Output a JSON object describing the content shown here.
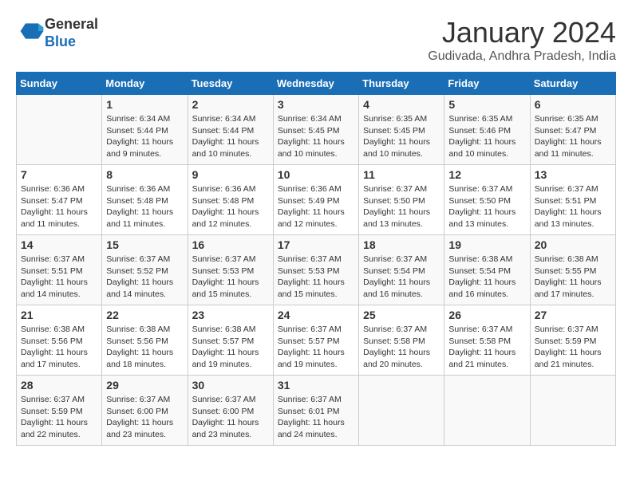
{
  "header": {
    "logo_line1": "General",
    "logo_line2": "Blue",
    "title": "January 2024",
    "subtitle": "Gudivada, Andhra Pradesh, India"
  },
  "calendar": {
    "days_of_week": [
      "Sunday",
      "Monday",
      "Tuesday",
      "Wednesday",
      "Thursday",
      "Friday",
      "Saturday"
    ],
    "weeks": [
      [
        {
          "day": "",
          "sunrise": "",
          "sunset": "",
          "daylight": ""
        },
        {
          "day": "1",
          "sunrise": "Sunrise: 6:34 AM",
          "sunset": "Sunset: 5:44 PM",
          "daylight": "Daylight: 11 hours and 9 minutes."
        },
        {
          "day": "2",
          "sunrise": "Sunrise: 6:34 AM",
          "sunset": "Sunset: 5:44 PM",
          "daylight": "Daylight: 11 hours and 10 minutes."
        },
        {
          "day": "3",
          "sunrise": "Sunrise: 6:34 AM",
          "sunset": "Sunset: 5:45 PM",
          "daylight": "Daylight: 11 hours and 10 minutes."
        },
        {
          "day": "4",
          "sunrise": "Sunrise: 6:35 AM",
          "sunset": "Sunset: 5:45 PM",
          "daylight": "Daylight: 11 hours and 10 minutes."
        },
        {
          "day": "5",
          "sunrise": "Sunrise: 6:35 AM",
          "sunset": "Sunset: 5:46 PM",
          "daylight": "Daylight: 11 hours and 10 minutes."
        },
        {
          "day": "6",
          "sunrise": "Sunrise: 6:35 AM",
          "sunset": "Sunset: 5:47 PM",
          "daylight": "Daylight: 11 hours and 11 minutes."
        }
      ],
      [
        {
          "day": "7",
          "sunrise": "Sunrise: 6:36 AM",
          "sunset": "Sunset: 5:47 PM",
          "daylight": "Daylight: 11 hours and 11 minutes."
        },
        {
          "day": "8",
          "sunrise": "Sunrise: 6:36 AM",
          "sunset": "Sunset: 5:48 PM",
          "daylight": "Daylight: 11 hours and 11 minutes."
        },
        {
          "day": "9",
          "sunrise": "Sunrise: 6:36 AM",
          "sunset": "Sunset: 5:48 PM",
          "daylight": "Daylight: 11 hours and 12 minutes."
        },
        {
          "day": "10",
          "sunrise": "Sunrise: 6:36 AM",
          "sunset": "Sunset: 5:49 PM",
          "daylight": "Daylight: 11 hours and 12 minutes."
        },
        {
          "day": "11",
          "sunrise": "Sunrise: 6:37 AM",
          "sunset": "Sunset: 5:50 PM",
          "daylight": "Daylight: 11 hours and 13 minutes."
        },
        {
          "day": "12",
          "sunrise": "Sunrise: 6:37 AM",
          "sunset": "Sunset: 5:50 PM",
          "daylight": "Daylight: 11 hours and 13 minutes."
        },
        {
          "day": "13",
          "sunrise": "Sunrise: 6:37 AM",
          "sunset": "Sunset: 5:51 PM",
          "daylight": "Daylight: 11 hours and 13 minutes."
        }
      ],
      [
        {
          "day": "14",
          "sunrise": "Sunrise: 6:37 AM",
          "sunset": "Sunset: 5:51 PM",
          "daylight": "Daylight: 11 hours and 14 minutes."
        },
        {
          "day": "15",
          "sunrise": "Sunrise: 6:37 AM",
          "sunset": "Sunset: 5:52 PM",
          "daylight": "Daylight: 11 hours and 14 minutes."
        },
        {
          "day": "16",
          "sunrise": "Sunrise: 6:37 AM",
          "sunset": "Sunset: 5:53 PM",
          "daylight": "Daylight: 11 hours and 15 minutes."
        },
        {
          "day": "17",
          "sunrise": "Sunrise: 6:37 AM",
          "sunset": "Sunset: 5:53 PM",
          "daylight": "Daylight: 11 hours and 15 minutes."
        },
        {
          "day": "18",
          "sunrise": "Sunrise: 6:37 AM",
          "sunset": "Sunset: 5:54 PM",
          "daylight": "Daylight: 11 hours and 16 minutes."
        },
        {
          "day": "19",
          "sunrise": "Sunrise: 6:38 AM",
          "sunset": "Sunset: 5:54 PM",
          "daylight": "Daylight: 11 hours and 16 minutes."
        },
        {
          "day": "20",
          "sunrise": "Sunrise: 6:38 AM",
          "sunset": "Sunset: 5:55 PM",
          "daylight": "Daylight: 11 hours and 17 minutes."
        }
      ],
      [
        {
          "day": "21",
          "sunrise": "Sunrise: 6:38 AM",
          "sunset": "Sunset: 5:56 PM",
          "daylight": "Daylight: 11 hours and 17 minutes."
        },
        {
          "day": "22",
          "sunrise": "Sunrise: 6:38 AM",
          "sunset": "Sunset: 5:56 PM",
          "daylight": "Daylight: 11 hours and 18 minutes."
        },
        {
          "day": "23",
          "sunrise": "Sunrise: 6:38 AM",
          "sunset": "Sunset: 5:57 PM",
          "daylight": "Daylight: 11 hours and 19 minutes."
        },
        {
          "day": "24",
          "sunrise": "Sunrise: 6:37 AM",
          "sunset": "Sunset: 5:57 PM",
          "daylight": "Daylight: 11 hours and 19 minutes."
        },
        {
          "day": "25",
          "sunrise": "Sunrise: 6:37 AM",
          "sunset": "Sunset: 5:58 PM",
          "daylight": "Daylight: 11 hours and 20 minutes."
        },
        {
          "day": "26",
          "sunrise": "Sunrise: 6:37 AM",
          "sunset": "Sunset: 5:58 PM",
          "daylight": "Daylight: 11 hours and 21 minutes."
        },
        {
          "day": "27",
          "sunrise": "Sunrise: 6:37 AM",
          "sunset": "Sunset: 5:59 PM",
          "daylight": "Daylight: 11 hours and 21 minutes."
        }
      ],
      [
        {
          "day": "28",
          "sunrise": "Sunrise: 6:37 AM",
          "sunset": "Sunset: 5:59 PM",
          "daylight": "Daylight: 11 hours and 22 minutes."
        },
        {
          "day": "29",
          "sunrise": "Sunrise: 6:37 AM",
          "sunset": "Sunset: 6:00 PM",
          "daylight": "Daylight: 11 hours and 23 minutes."
        },
        {
          "day": "30",
          "sunrise": "Sunrise: 6:37 AM",
          "sunset": "Sunset: 6:00 PM",
          "daylight": "Daylight: 11 hours and 23 minutes."
        },
        {
          "day": "31",
          "sunrise": "Sunrise: 6:37 AM",
          "sunset": "Sunset: 6:01 PM",
          "daylight": "Daylight: 11 hours and 24 minutes."
        },
        {
          "day": "",
          "sunrise": "",
          "sunset": "",
          "daylight": ""
        },
        {
          "day": "",
          "sunrise": "",
          "sunset": "",
          "daylight": ""
        },
        {
          "day": "",
          "sunrise": "",
          "sunset": "",
          "daylight": ""
        }
      ]
    ]
  }
}
